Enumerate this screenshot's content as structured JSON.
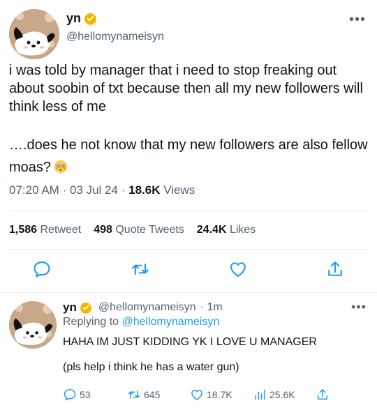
{
  "main_tweet": {
    "author_name": "yn",
    "author_handle": "@hellomynameisyn",
    "more_label": "•••",
    "text_paragraph_1": "i was told by manager that i need to stop freaking out about soobin of txt because then all my new followers will think less of me",
    "text_paragraph_2": "….does he not know that my new followers are also fellow moas?",
    "emoji_icon": "flushed-face-icon",
    "time": "07:20 AM",
    "separator": "·",
    "date": "03 Jul 24",
    "views_count": "18.6K",
    "views_label": "Views",
    "stats": {
      "retweets_count": "1,586",
      "retweets_label": "Retweet",
      "quotes_count": "498",
      "quotes_label": "Quote Tweets",
      "likes_count": "24.4K",
      "likes_label": "Likes"
    },
    "actions": [
      "reply-icon",
      "retweet-icon",
      "like-icon",
      "share-icon"
    ]
  },
  "reply_tweet": {
    "author_name": "yn",
    "author_handle": "@hellomynameisyn",
    "time_ago": "· 1m",
    "more_label": "•••",
    "replying_to_label": "Replying to",
    "replying_to_handle": "@hellomynameisyn",
    "text_line_1": "HAHA IM JUST KIDDING YK I LOVE U MANAGER",
    "text_line_2": "(pls help i think he has a water gun)",
    "counts": {
      "replies": "53",
      "retweets": "645",
      "likes": "18.7K",
      "views": "25.6K"
    }
  },
  "colors": {
    "verified_badge": "#f4b400",
    "link": "#1d9bf0",
    "secondary_text": "#536471",
    "action_icon": "#1d9bf0",
    "divider": "#e6e9eb"
  }
}
